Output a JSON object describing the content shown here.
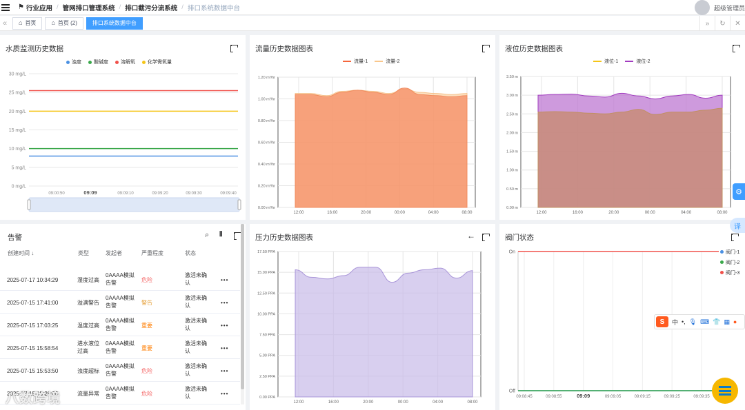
{
  "topbar": {
    "breadcrumbs": [
      "行业应用",
      "管网排口管理系统",
      "排口截污分流系统",
      "排口系统数据中台"
    ],
    "username": "超级管理员"
  },
  "tags": [
    {
      "label": "首页",
      "icon": "home-icon"
    },
    {
      "label": "首页 (2)",
      "icon": "home-icon"
    },
    {
      "label": "排口系统数据中台",
      "active": true
    }
  ],
  "panels": {
    "water": {
      "title": "水质监测历史数据",
      "legend": [
        {
          "name": "浊度",
          "color": "#4a90e2"
        },
        {
          "name": "酸碱度",
          "color": "#3aa84a"
        },
        {
          "name": "溶解氧",
          "color": "#f0504a"
        },
        {
          "name": "化学需氧量",
          "color": "#f5c518"
        }
      ],
      "yticks": [
        "30 mg/L",
        "25 mg/L",
        "20 mg/L",
        "15 mg/L",
        "10 mg/L",
        "5 mg/L",
        "0 mg/L"
      ],
      "xticks": [
        "09:00:50",
        "09:09",
        "09:09:10",
        "09:09:20",
        "09:09:30",
        "09:09:40"
      ]
    },
    "flow": {
      "title": "流量历史数据图表",
      "legend": [
        {
          "name": "流量-1",
          "color": "#f5663c"
        },
        {
          "name": "流量-2",
          "color": "#f9c78c"
        }
      ],
      "yticks": [
        "1.20 m³/hr",
        "1.00 m³/hr",
        "0.80 m³/hr",
        "0.60 m³/hr",
        "0.40 m³/hr",
        "0.20 m³/hr",
        "0.00 m³/hr"
      ],
      "xticks": [
        "12:00",
        "16:00",
        "20:00",
        "00:00",
        "04:00",
        "08:00"
      ]
    },
    "level": {
      "title": "液位历史数据图表",
      "legend": [
        {
          "name": "液位-1",
          "color": "#f5c518"
        },
        {
          "name": "液位-2",
          "color": "#a23cc0"
        }
      ],
      "yticks": [
        "3.50 m",
        "3.00 m",
        "2.50 m",
        "2.00 m",
        "1.50 m",
        "1.00 m",
        "0.50 m",
        "0.00 m"
      ],
      "xticks": [
        "12:00",
        "16:00",
        "20:00",
        "00:00",
        "04:00",
        "08:00"
      ]
    },
    "alarm": {
      "title": "告警",
      "columns": [
        "创建时间",
        "类型",
        "发起者",
        "严重程度",
        "状态"
      ],
      "rows": [
        {
          "time": "2025-07-17 10:34:29",
          "type": [
            "湿度过高"
          ],
          "by": [
            "0AAAA模拟",
            "告警"
          ],
          "sev": "危险",
          "sevClass": "sev-red",
          "status": [
            "激活未确",
            "认"
          ]
        },
        {
          "time": "2025-07-15 17:41:00",
          "type": [
            "溢满警告"
          ],
          "by": [
            "0AAAA模拟",
            "告警"
          ],
          "sev": "警告",
          "sevClass": "sev-yel",
          "status": [
            "激活未确",
            "认"
          ]
        },
        {
          "time": "2025-07-15 17:03:25",
          "type": [
            "温度过高"
          ],
          "by": [
            "0AAAA模拟",
            "告警"
          ],
          "sev": "重要",
          "sevClass": "sev-org",
          "status": [
            "激活未确",
            "认"
          ]
        },
        {
          "time": "2025-07-15 15:58:54",
          "type": [
            "进水液位",
            "过高"
          ],
          "by": [
            "0AAAA模拟",
            "告警"
          ],
          "sev": "重要",
          "sevClass": "sev-org",
          "status": [
            "激活未确",
            "认"
          ]
        },
        {
          "time": "2025-07-15 15:53:50",
          "type": [
            "浊度超标"
          ],
          "by": [
            "0AAAA模拟",
            "告警"
          ],
          "sev": "危险",
          "sevClass": "sev-red",
          "status": [
            "激活未确",
            "认"
          ]
        },
        {
          "time": "2025-07-15 15:28:00",
          "type": [
            "流量异常"
          ],
          "by": [
            "0AAAA模拟",
            "告警"
          ],
          "sev": "危险",
          "sevClass": "sev-red",
          "status": [
            "激活未确",
            "认"
          ]
        }
      ]
    },
    "pressure": {
      "title": "压力历史数据图表",
      "yticks": [
        "17.50 PPA",
        "15.00 PPA",
        "12.50 PPA",
        "10.00 PPA",
        "7.50 PPA",
        "5.00 PPA",
        "2.50 PPA",
        "0.00 PPA"
      ],
      "xticks": [
        "12:00",
        "16:00",
        "20:00",
        "00:00",
        "04:00",
        "08:00"
      ]
    },
    "valve": {
      "title": "阀门状态",
      "legend": [
        {
          "name": "阀门-1",
          "color": "#4a90e2"
        },
        {
          "name": "阀门-2",
          "color": "#3aa84a"
        },
        {
          "name": "阀门-3",
          "color": "#f0504a"
        }
      ],
      "yticks": [
        "On",
        "Off"
      ],
      "xticks": [
        "09:08:45",
        "09:08:55",
        "09:09",
        "09:09:05",
        "09:09:15",
        "09:09:25",
        "09:09:35"
      ]
    }
  },
  "ime": {
    "label": "中"
  },
  "side": {
    "translate": "译"
  },
  "watermark": "八数跨境",
  "chart_data": [
    {
      "type": "line",
      "title": "水质监测历史数据",
      "ylabel": "mg/L",
      "ylim": [
        0,
        30
      ],
      "x": [
        "09:00:50",
        "09:09",
        "09:09:10",
        "09:09:20",
        "09:09:30",
        "09:09:40"
      ],
      "series": [
        {
          "name": "浊度",
          "values": [
            8,
            8,
            8,
            8,
            8,
            8
          ]
        },
        {
          "name": "酸碱度",
          "values": [
            10,
            10,
            10,
            10,
            10,
            10
          ]
        },
        {
          "name": "溶解氧",
          "values": [
            25.5,
            25.5,
            25.5,
            25.5,
            25.5,
            25.5
          ]
        },
        {
          "name": "化学需氧量",
          "values": [
            20,
            20,
            20,
            20,
            20,
            20
          ]
        }
      ]
    },
    {
      "type": "area",
      "title": "流量历史数据图表",
      "ylim": [
        0,
        1.2
      ],
      "x": [
        "12:00",
        "16:00",
        "20:00",
        "00:00",
        "04:00",
        "08:00"
      ],
      "series": [
        {
          "name": "流量-1",
          "values": [
            1.04,
            1.04,
            1.02,
            1.06,
            1.08,
            1.06,
            1.04,
            1.1,
            1.04,
            1.03,
            1.02,
            1.03
          ]
        },
        {
          "name": "流量-2",
          "values": [
            1.05,
            1.05,
            1.03,
            1.07,
            1.08,
            1.07,
            1.05,
            1.09,
            1.06,
            1.05,
            1.04,
            1.05
          ]
        }
      ]
    },
    {
      "type": "area",
      "title": "液位历史数据图表",
      "ylim": [
        0,
        3.5
      ],
      "x": [
        "12:00",
        "16:00",
        "20:00",
        "00:00",
        "04:00",
        "08:00"
      ],
      "series": [
        {
          "name": "液位-1",
          "values": [
            2.55,
            2.56,
            2.55,
            2.52,
            2.5,
            2.55,
            2.62,
            2.48,
            2.55,
            2.55,
            2.6,
            2.65
          ]
        },
        {
          "name": "液位-2",
          "values": [
            3.0,
            3.02,
            3.03,
            2.98,
            2.95,
            3.05,
            2.98,
            2.9,
            2.98,
            3.02,
            2.92,
            3.0
          ]
        }
      ]
    },
    {
      "type": "area",
      "title": "压力历史数据图表",
      "ylim": [
        0,
        17.5
      ],
      "x": [
        "12:00",
        "16:00",
        "20:00",
        "00:00",
        "04:00",
        "08:00"
      ],
      "series": [
        {
          "name": "压力",
          "values": [
            15.3,
            14.4,
            14.2,
            14.6,
            15.6,
            15.6,
            13.8,
            14.9,
            15.3,
            15.5,
            14.3,
            15.2
          ]
        }
      ]
    },
    {
      "type": "line",
      "title": "阀门状态",
      "x": [
        "09:08:45",
        "09:08:55",
        "09:09",
        "09:09:05",
        "09:09:15",
        "09:09:25",
        "09:09:35"
      ],
      "series": [
        {
          "name": "阀门-1",
          "values": [
            0,
            0,
            0,
            0,
            0,
            0,
            0
          ]
        },
        {
          "name": "阀门-2",
          "values": [
            0,
            0,
            0,
            0,
            0,
            0,
            0
          ]
        },
        {
          "name": "阀门-3",
          "values": [
            1,
            1,
            1,
            1,
            1,
            1,
            1
          ]
        }
      ]
    }
  ]
}
